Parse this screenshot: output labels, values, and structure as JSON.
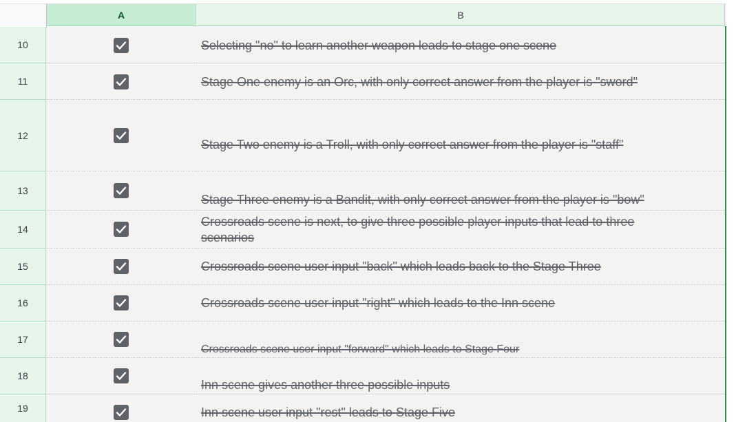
{
  "columns": {
    "a": "A",
    "b": "B"
  },
  "rows": [
    {
      "num": "10",
      "checked": true,
      "text": "Selecting \"no\" to learn another weapon leads to stage one scene"
    },
    {
      "num": "11",
      "checked": true,
      "text": "Stage One enemy is an Orc, with only correct answer from the player is \"sword\""
    },
    {
      "num": "12",
      "checked": true,
      "text": "Stage Two enemy is a Troll, with only correct answer from the player is \"staff\""
    },
    {
      "num": "13",
      "checked": true,
      "text": "Stage Three enemy is a Bandit, with only correct answer from the player is \"bow\""
    },
    {
      "num": "14",
      "checked": true,
      "text": "Crossroads scene is next, to give three possible player inputs that lead to three scenarios"
    },
    {
      "num": "15",
      "checked": true,
      "text": "Crossroads scene user input \"back\" which leads back to the Stage Three"
    },
    {
      "num": "16",
      "checked": true,
      "text": "Crossroads scene user input \"right\" which leads to the Inn scene"
    },
    {
      "num": "17",
      "checked": true,
      "text": "Crossroads scene user input \"forward\" which leads to Stage Four"
    },
    {
      "num": "18",
      "checked": true,
      "text": "Inn scene gives another three possible inputs"
    },
    {
      "num": "19",
      "checked": true,
      "text": "Inn scene user input \"rest\" leads to Stage Five"
    }
  ],
  "colors": {
    "header_selected": "#c7ecd4",
    "rownum_bg": "#e6f4ea",
    "checkbox": "#5f6368",
    "selection_border": "#2f8f4e"
  }
}
